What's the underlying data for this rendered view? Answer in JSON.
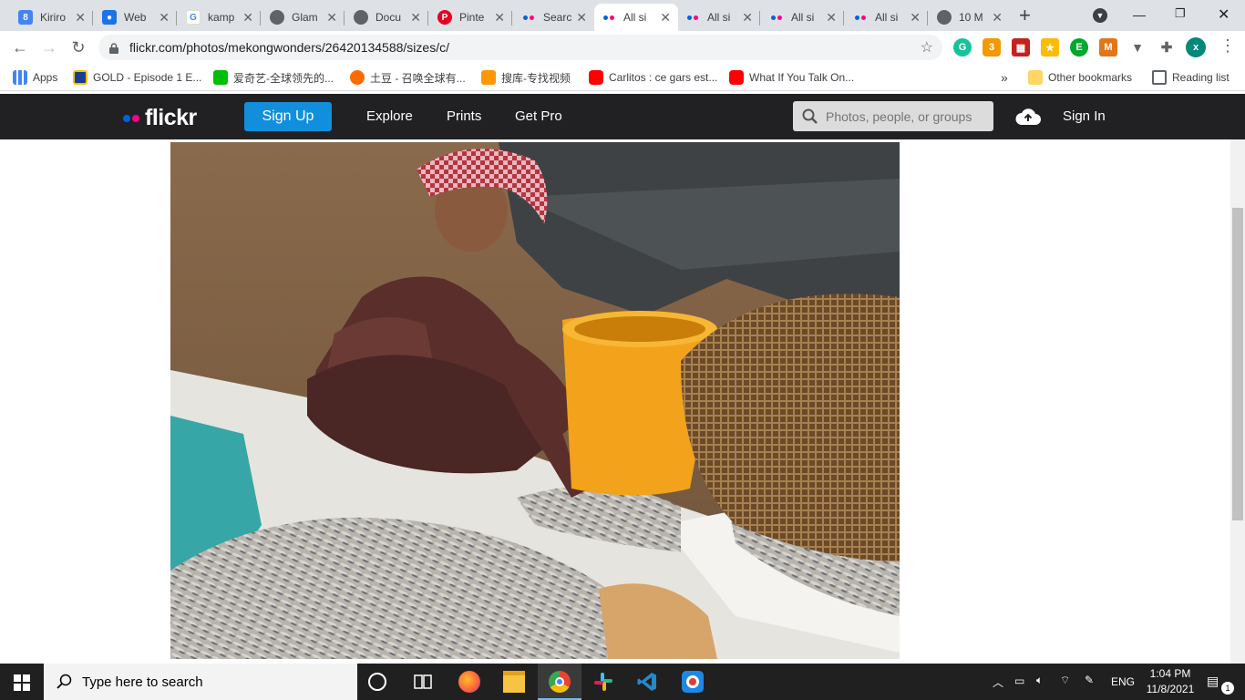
{
  "tabs": [
    {
      "title": "Kiriro",
      "favicon": "calendar-icon",
      "color": "#4285f4"
    },
    {
      "title": "Web",
      "favicon": "account-icon",
      "color": "#1a73e8"
    },
    {
      "title": "kamp",
      "favicon": "google-icon",
      "color": "#ffffff"
    },
    {
      "title": "Glam",
      "favicon": "globe-icon",
      "color": "#5f6368"
    },
    {
      "title": "Docu",
      "favicon": "globe-icon",
      "color": "#5f6368"
    },
    {
      "title": "Pinte",
      "favicon": "pinterest-icon",
      "color": "#e60023"
    },
    {
      "title": "Searc",
      "favicon": "flickr-icon",
      "color": "#0063dc"
    },
    {
      "title": "All si",
      "favicon": "flickr-icon",
      "color": "#0063dc",
      "active": true
    },
    {
      "title": "All si",
      "favicon": "flickr-icon",
      "color": "#0063dc"
    },
    {
      "title": "All si",
      "favicon": "flickr-icon",
      "color": "#0063dc"
    },
    {
      "title": "All si",
      "favicon": "flickr-icon",
      "color": "#0063dc"
    },
    {
      "title": "10 M",
      "favicon": "globe-icon",
      "color": "#5f6368"
    }
  ],
  "toolbar": {
    "url": "flickr.com/photos/mekongwonders/26420134588/sizes/c/",
    "profile_initial": "x"
  },
  "bookmarks": {
    "items": [
      {
        "label": "Apps"
      },
      {
        "label": "GOLD - Episode 1 E..."
      },
      {
        "label": "爱奇艺-全球领先的..."
      },
      {
        "label": "土豆 - 召唤全球有..."
      },
      {
        "label": "搜库-专找视频"
      },
      {
        "label": "Carlitos : ce gars est..."
      },
      {
        "label": "What If You Talk On..."
      }
    ],
    "overflow": "»",
    "other": "Other bookmarks",
    "reading_list": "Reading list"
  },
  "flickr_nav": {
    "logo": "flickr",
    "signup": "Sign Up",
    "explore": "Explore",
    "prints": "Prints",
    "getpro": "Get Pro",
    "search_placeholder": "Photos, people, or groups",
    "signin": "Sign In"
  },
  "taskbar": {
    "search_placeholder": "Type here to search",
    "lang": "ENG",
    "time": "1:04 PM",
    "date": "11/8/2021",
    "notifications": "1"
  }
}
